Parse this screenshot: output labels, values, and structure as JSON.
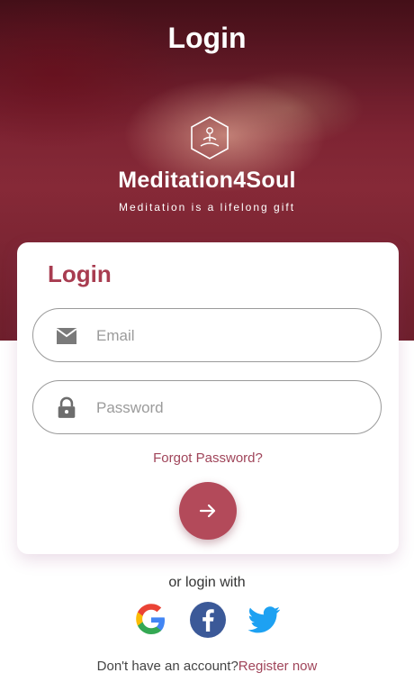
{
  "header": {
    "title": "Login"
  },
  "branding": {
    "app_name": "Meditation4Soul",
    "tagline": "Meditation is a lifelong gift",
    "logo_icon": "meditation-logo-icon"
  },
  "login_card": {
    "title": "Login",
    "email": {
      "placeholder": "Email",
      "value": "",
      "icon": "mail-icon"
    },
    "password": {
      "placeholder": "Password",
      "value": "",
      "icon": "lock-icon"
    },
    "forgot_password": "Forgot Password?",
    "submit_icon": "arrow-right-icon"
  },
  "social_login": {
    "prompt": "or login with",
    "providers": [
      "google-icon",
      "facebook-icon",
      "twitter-icon"
    ]
  },
  "register": {
    "prompt": "Don't have an account?",
    "link": "Register now"
  },
  "colors": {
    "accent": "#b34a5a",
    "accent_text": "#a0455a",
    "hero_base": "#7e2232"
  }
}
